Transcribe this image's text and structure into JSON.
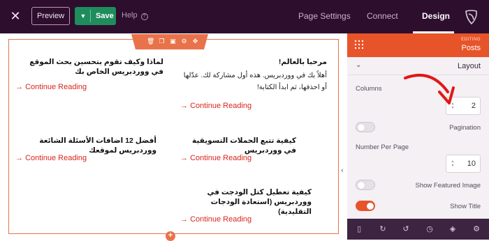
{
  "topbar": {
    "preview_label": "Preview",
    "save_label": "Save",
    "help_label": "Help",
    "tabs": [
      "Page Settings",
      "Connect",
      "Design"
    ],
    "active_tab": "Design"
  },
  "posts": [
    {
      "title": "مرحبا بالعالم!",
      "excerpt": "أهلاً بك في ووردبريس. هذه أول مشاركة لك. عدّلها أو احذفها، ثم ابدأ الكتابة!",
      "link": "Continue Reading"
    },
    {
      "title": "لماذا وكيف تقوم بتحسين بحث الموقع في ووردبريس الخاص بك",
      "excerpt": "",
      "link": "Continue Reading"
    },
    {
      "title": "كيفية تتبع الحملات التسويقية في ووردبريس",
      "excerpt": "",
      "link": "Continue Reading"
    },
    {
      "title": "أفضل 12 اضافات الأسئلة الشائعة ووردبريس لموقعك",
      "excerpt": "",
      "link": "Continue Reading"
    },
    {
      "title": "كيفية تعطيل كتل الودجت في ووردبريس (استعادة الودجات التقليدية)",
      "excerpt": "",
      "link": "Continue Reading"
    }
  ],
  "panel": {
    "editing_label": "EDITING",
    "block_title": "Posts",
    "section_label": "Layout",
    "columns_label": "Columns",
    "columns_value": "2",
    "pagination_label": "Pagination",
    "pagination_on": false,
    "number_per_page_label": "Number Per Page",
    "number_per_page_value": "10",
    "show_featured_image_label": "Show Featured Image",
    "show_featured_image_on": false,
    "show_title_label": "Show Title",
    "show_title_on": true
  },
  "colors": {
    "topbar_bg": "#2d0f2d",
    "accent": "#e8542a",
    "save_green": "#1e8c5c",
    "link_red": "#d9241b",
    "outline": "#e8734a"
  },
  "icons": {
    "close": "close-icon",
    "help": "help-icon",
    "logo": "brand-logo-icon",
    "grid": "grid-icon",
    "toolbar": [
      "trash-icon",
      "duplicate-icon",
      "save-block-icon",
      "settings-icon",
      "move-icon"
    ],
    "footer": [
      "mobile-preview-icon",
      "refresh-icon",
      "undo-icon",
      "history-icon",
      "layers-icon",
      "settings-icon"
    ]
  }
}
